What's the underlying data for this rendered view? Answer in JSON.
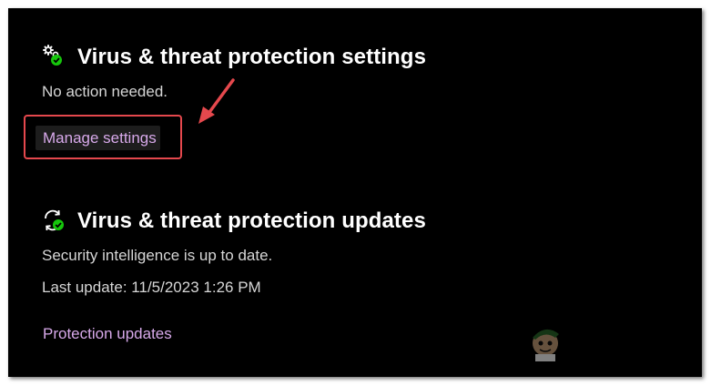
{
  "settings_section": {
    "title": "Virus & threat protection settings",
    "status": "No action needed.",
    "link_label": "Manage settings",
    "icon": "gear-settings-check-icon"
  },
  "updates_section": {
    "title": "Virus & threat protection updates",
    "status": "Security intelligence is up to date.",
    "last_update": "Last update: 11/5/2023 1:26 PM",
    "link_label": "Protection updates",
    "icon": "refresh-check-icon"
  },
  "annotation": {
    "highlight_color": "#e5484d",
    "arrow_color": "#e5484d"
  },
  "colors": {
    "background": "#000000",
    "link": "#d7a9ea",
    "check_badge": "#16c60c"
  }
}
